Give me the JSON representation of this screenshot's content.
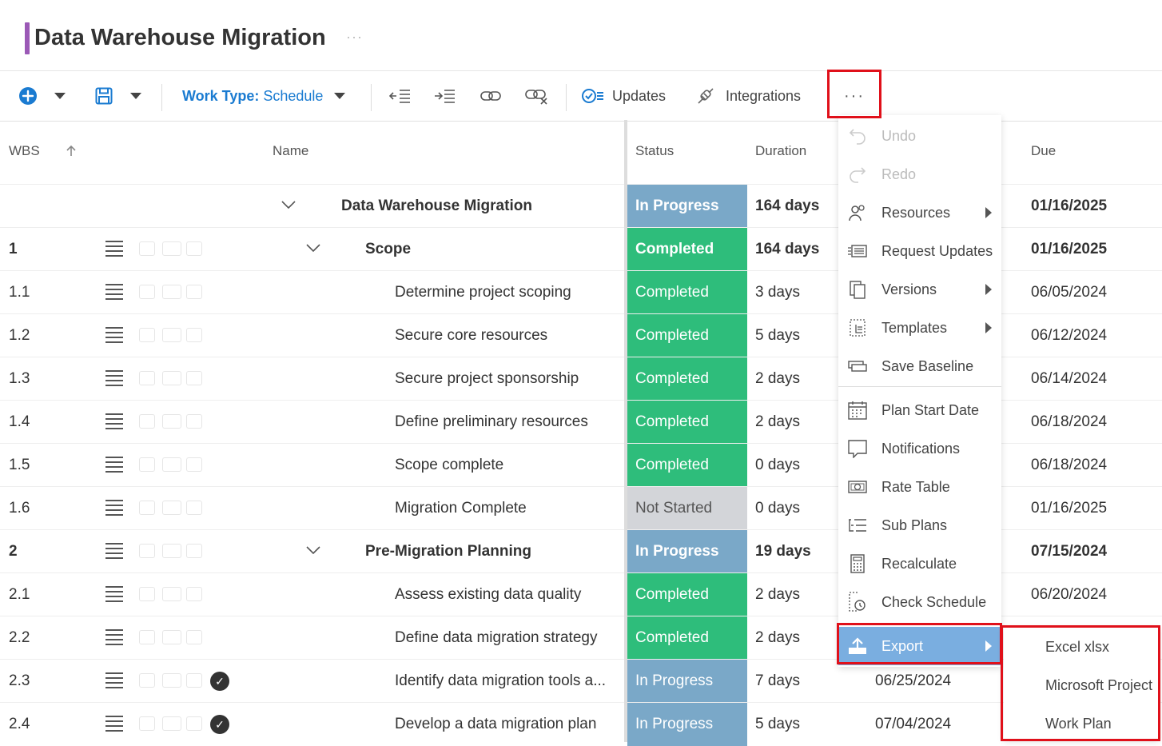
{
  "header": {
    "title": "Data Warehouse Migration",
    "more": "···"
  },
  "toolbar": {
    "work_type_label": "Work Type:",
    "work_type_value": "Schedule",
    "updates": "Updates",
    "integrations": "Integrations",
    "more": "···"
  },
  "columns": {
    "wbs": "WBS",
    "name": "Name",
    "status": "Status",
    "duration": "Duration",
    "due": "Due"
  },
  "rows": [
    {
      "wbs": "",
      "name": "Data Warehouse Migration",
      "status": "In Progress",
      "duration": "164 days",
      "due": "01/16/2025"
    },
    {
      "wbs": "1",
      "name": "Scope",
      "status": "Completed",
      "duration": "164 days",
      "due": "01/16/2025"
    },
    {
      "wbs": "1.1",
      "name": "Determine project scoping",
      "status": "Completed",
      "duration": "3 days",
      "due": "06/05/2024"
    },
    {
      "wbs": "1.2",
      "name": "Secure core resources",
      "status": "Completed",
      "duration": "5 days",
      "due": "06/12/2024"
    },
    {
      "wbs": "1.3",
      "name": "Secure project sponsorship",
      "status": "Completed",
      "duration": "2 days",
      "due": "06/14/2024"
    },
    {
      "wbs": "1.4",
      "name": "Define preliminary resources",
      "status": "Completed",
      "duration": "2 days",
      "due": "06/18/2024"
    },
    {
      "wbs": "1.5",
      "name": "Scope complete",
      "status": "Completed",
      "duration": "0 days",
      "due": "06/18/2024"
    },
    {
      "wbs": "1.6",
      "name": "Migration Complete",
      "status": "Not Started",
      "duration": "0 days",
      "due": "01/16/2025"
    },
    {
      "wbs": "2",
      "name": "Pre-Migration Planning",
      "status": "In Progress",
      "duration": "19 days",
      "due": "07/15/2024"
    },
    {
      "wbs": "2.1",
      "name": "Assess existing data quality",
      "status": "Completed",
      "duration": "2 days",
      "due": "06/20/2024"
    },
    {
      "wbs": "2.2",
      "name": "Define data migration strategy",
      "status": "Completed",
      "duration": "2 days",
      "due": ""
    },
    {
      "wbs": "2.3",
      "name": "Identify data migration tools a...",
      "status": "In Progress",
      "duration": "7 days",
      "due": "06/25/2024"
    },
    {
      "wbs": "2.4",
      "name": "Develop a data migration plan",
      "status": "In Progress",
      "duration": "5 days",
      "due": "07/04/2024"
    }
  ],
  "menu": {
    "undo": "Undo",
    "redo": "Redo",
    "resources": "Resources",
    "request_updates": "Request Updates",
    "versions": "Versions",
    "templates": "Templates",
    "save_baseline": "Save Baseline",
    "plan_start_date": "Plan Start Date",
    "notifications": "Notifications",
    "rate_table": "Rate Table",
    "sub_plans": "Sub Plans",
    "recalculate": "Recalculate",
    "check_schedule": "Check Schedule",
    "export": "Export"
  },
  "export_submenu": {
    "excel": "Excel xlsx",
    "msproject": "Microsoft Project",
    "workplan": "Work Plan"
  },
  "colors": {
    "accent": "#9b59b6",
    "completed": "#2ebd7b",
    "in_progress": "#7aa8c8",
    "not_started": "#d3d5d9",
    "highlight": "#e0101a",
    "primary": "#1a7bd1"
  }
}
